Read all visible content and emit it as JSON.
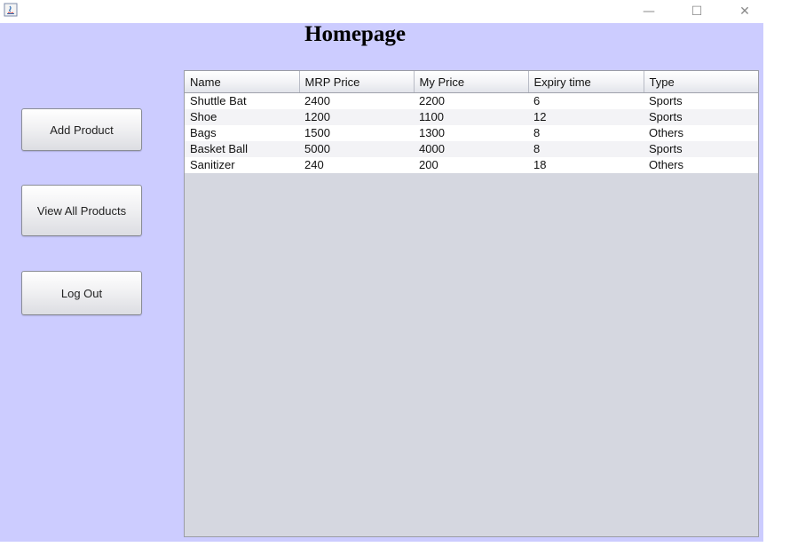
{
  "window": {
    "controls": {
      "minimize": "—",
      "maximize": "☐",
      "close": "✕"
    }
  },
  "page": {
    "title": "Homepage"
  },
  "sidebar": {
    "add_product": "Add Product",
    "view_all_products": "View All Products",
    "log_out": "Log Out"
  },
  "table": {
    "columns": [
      "Name",
      "MRP Price",
      "My Price",
      "Expiry time",
      "Type"
    ],
    "rows": [
      [
        "Shuttle Bat",
        "2400",
        "2200",
        "6",
        "Sports"
      ],
      [
        "Shoe",
        "1200",
        "1100",
        "12",
        "Sports"
      ],
      [
        "Bags",
        "1500",
        "1300",
        "8",
        "Others"
      ],
      [
        "Basket Ball",
        "5000",
        "4000",
        "8",
        "Sports"
      ],
      [
        "Sanitizer",
        "240",
        "200",
        "18",
        "Others"
      ]
    ]
  },
  "colors": {
    "content_background": "#ccccff",
    "table_empty_area": "#d5d7e0"
  }
}
